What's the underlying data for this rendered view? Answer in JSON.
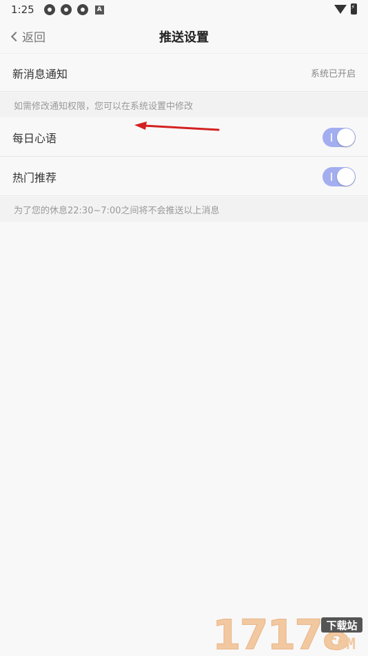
{
  "status_bar": {
    "time": "1:25",
    "badge_letter": "A"
  },
  "nav": {
    "back_label": "返回",
    "title": "推送设置"
  },
  "settings": {
    "new_message": {
      "label": "新消息通知",
      "value": "系统已开启"
    },
    "permission_hint": "如需修改通知权限，您可以在系统设置中修改",
    "daily_quote": {
      "label": "每日心语",
      "enabled": true
    },
    "hot_recommend": {
      "label": "热门推荐",
      "enabled": true
    },
    "quiet_hint": "为了您的休息22:30~7:00之间将不会推送以上消息"
  },
  "watermark": {
    "number": "17178",
    "badge": "下载站",
    "domain": "COM"
  },
  "colors": {
    "toggle_on": "#a3aef0",
    "annotation_arrow": "#d42020",
    "background": "#f8f8f8"
  }
}
